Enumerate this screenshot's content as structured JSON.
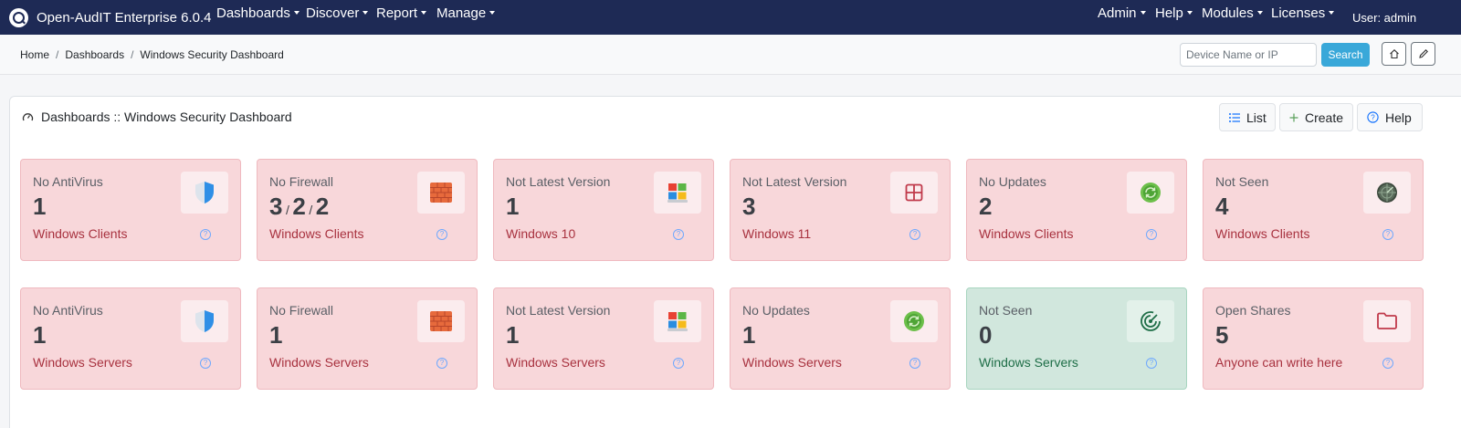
{
  "app": {
    "title": "Open-AudIT Enterprise 6.0.4"
  },
  "nav": {
    "left": [
      {
        "label": "Dashboards"
      },
      {
        "label": "Discover"
      },
      {
        "label": "Report"
      },
      {
        "label": "Manage"
      }
    ],
    "right": [
      {
        "label": "Admin"
      },
      {
        "label": "Help"
      },
      {
        "label": "Modules"
      },
      {
        "label": "Licenses"
      }
    ],
    "user": "User: admin"
  },
  "breadcrumb": [
    "Home",
    "Dashboards",
    "Windows Security Dashboard"
  ],
  "search": {
    "placeholder": "Device Name or IP",
    "button": "Search"
  },
  "header": {
    "title": "Dashboards :: Windows Security Dashboard",
    "buttons": {
      "list": "List",
      "create": "Create",
      "help": "Help"
    }
  },
  "tiles": [
    {
      "label": "No AntiVirus",
      "value": "1",
      "sub": "Windows Clients",
      "icon": "shield-icon",
      "status": "bad"
    },
    {
      "label": "No Firewall",
      "values": [
        "3",
        "2",
        "2"
      ],
      "sub": "Windows Clients",
      "icon": "firewall-icon",
      "status": "bad"
    },
    {
      "label": "Not Latest Version",
      "value": "1",
      "sub": "Windows 10",
      "icon": "windows-logo-icon",
      "status": "bad"
    },
    {
      "label": "Not Latest Version",
      "value": "3",
      "sub": "Windows 11",
      "icon": "windows-outline-icon",
      "status": "bad"
    },
    {
      "label": "No Updates",
      "value": "2",
      "sub": "Windows Clients",
      "icon": "update-icon",
      "status": "bad"
    },
    {
      "label": "Not Seen",
      "value": "4",
      "sub": "Windows Clients",
      "icon": "radar-icon",
      "status": "bad"
    },
    {
      "label": "No AntiVirus",
      "value": "1",
      "sub": "Windows Servers",
      "icon": "shield-icon",
      "status": "bad"
    },
    {
      "label": "No Firewall",
      "value": "1",
      "sub": "Windows Servers",
      "icon": "firewall-icon",
      "status": "bad"
    },
    {
      "label": "Not Latest Version",
      "value": "1",
      "sub": "Windows Servers",
      "icon": "windows-logo-icon",
      "status": "bad"
    },
    {
      "label": "No Updates",
      "value": "1",
      "sub": "Windows Servers",
      "icon": "update-icon",
      "status": "bad"
    },
    {
      "label": "Not Seen",
      "value": "0",
      "sub": "Windows Servers",
      "icon": "radar-icon",
      "status": "good"
    },
    {
      "label": "Open Shares",
      "value": "5",
      "sub": "Anyone can write here",
      "icon": "folder-icon",
      "status": "bad"
    }
  ],
  "colors": {
    "navbar": "#1e2a55",
    "bad_tile": "#f8d7da",
    "good_tile": "#d1e7dd",
    "search_button": "#39a8d9"
  }
}
